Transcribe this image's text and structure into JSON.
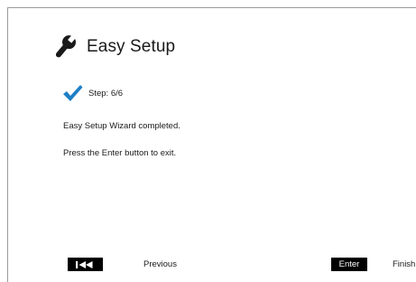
{
  "header": {
    "icon": "wrench-icon",
    "title": "Easy Setup"
  },
  "step": {
    "icon": "checkmark-icon",
    "label": "Step: 6/6"
  },
  "messages": [
    "Easy Setup Wizard completed.",
    "Press the Enter button to exit."
  ],
  "footer": {
    "previous": {
      "key_icon": "skip-previous-icon",
      "label": "Previous"
    },
    "finish": {
      "key_label": "Enter",
      "label": "Finish"
    }
  },
  "colors": {
    "background": "#ffffff",
    "check_blue": "#1e7fc4",
    "key_background": "#000000",
    "frame_border": "#9a9a9a"
  }
}
